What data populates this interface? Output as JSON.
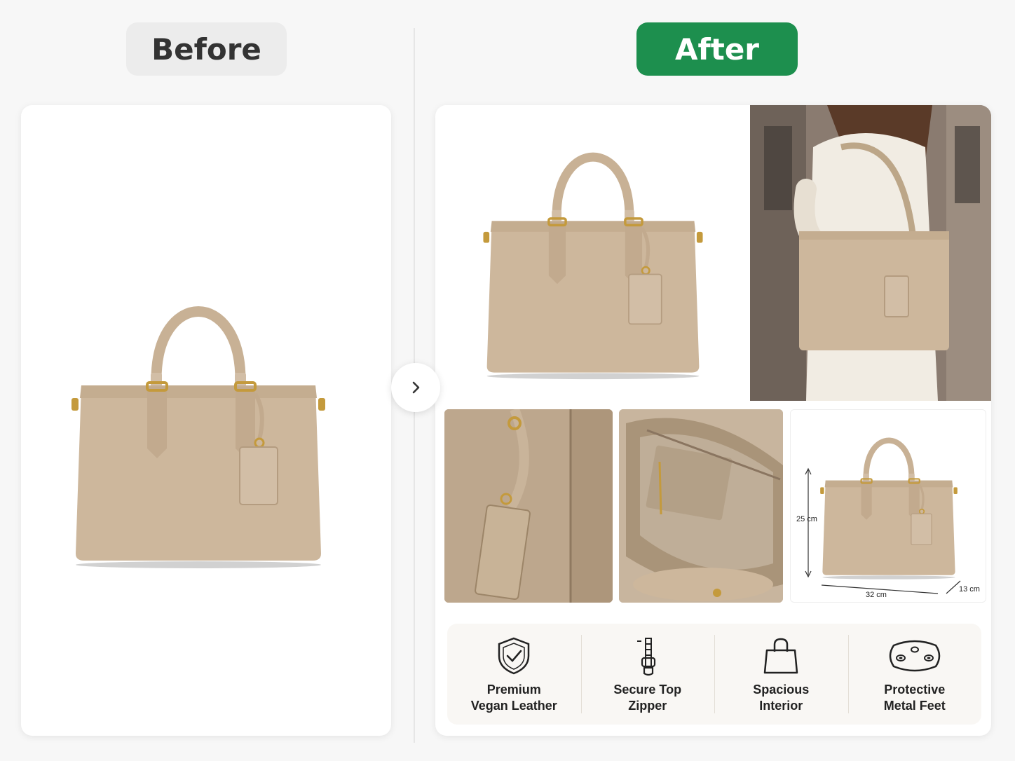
{
  "before_label": "Before",
  "after_label": "After",
  "colors": {
    "after_accent": "#1d8f4e",
    "before_pill_bg": "#ececec",
    "bag_beige": "#cdb79c",
    "hardware_gold": "#c49a3c"
  },
  "icons": {
    "next_arrow": "chevron-right-icon",
    "features": [
      "shield-check-icon",
      "zipper-icon",
      "shopping-bag-icon",
      "metal-feet-icon"
    ]
  },
  "dimensions": {
    "height": "25 cm",
    "width": "32 cm",
    "depth": "13 cm"
  },
  "features": [
    {
      "line1": "Premium",
      "line2": "Vegan Leather"
    },
    {
      "line1": "Secure Top",
      "line2": "Zipper"
    },
    {
      "line1": "Spacious",
      "line2": "Interior"
    },
    {
      "line1": "Protective",
      "line2": "Metal Feet"
    }
  ]
}
